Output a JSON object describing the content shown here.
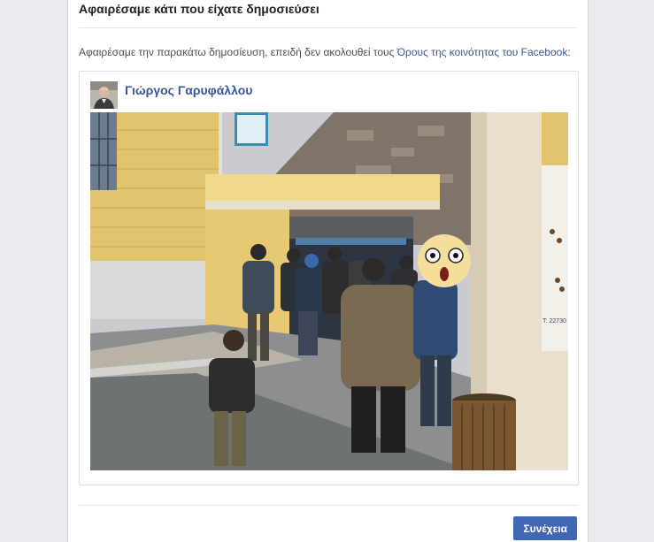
{
  "dialog": {
    "title": "Αφαιρέσαμε κάτι που είχατε δημοσιεύσει",
    "notice_prefix": "Αφαιρέσαμε την παρακάτω δημοσίευση, επειδή δεν ακολουθεί τους ",
    "notice_link": "Όρους της κοινότητας του Facebook",
    "notice_suffix": ":"
  },
  "post": {
    "author": "Γιώργος Γαρυφάλλου",
    "sign_text": "Τ: 22730"
  },
  "footer": {
    "continue_label": "Συνέχεια"
  },
  "colors": {
    "link": "#365899",
    "button": "#4267b2",
    "page_background": "#e9ebee"
  }
}
